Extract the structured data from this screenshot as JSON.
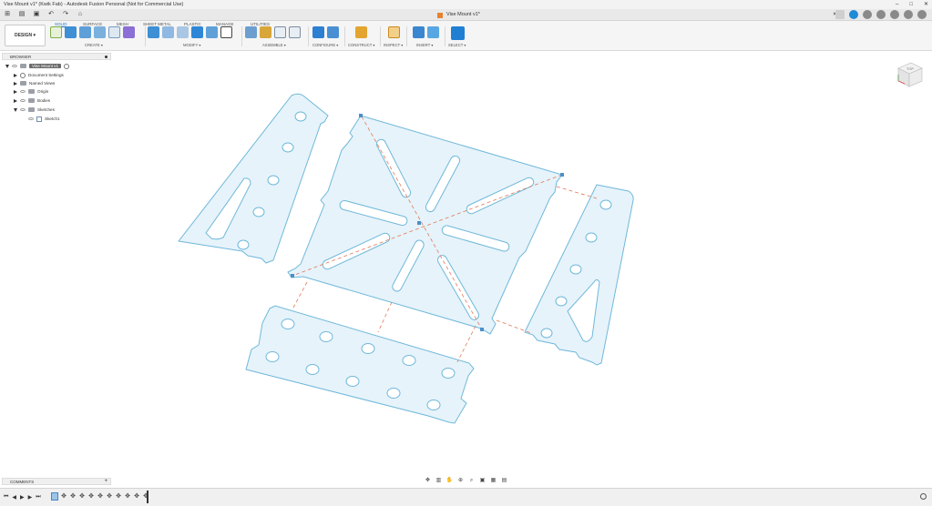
{
  "window": {
    "title": "Vise Mount v1* (Kwik Fab) - Autodesk Fusion Personal (Not for Commercial Use)",
    "controls": [
      "–",
      "□",
      "✕"
    ]
  },
  "document_tab": {
    "name": "Vise Mount v1*",
    "close": "✕"
  },
  "ribbon": {
    "design_button": "DESIGN ▾",
    "tabs": [
      "SOLID",
      "SURFACE",
      "MESH",
      "SHEET METAL",
      "PLASTIC",
      "MANAGE",
      "UTILITIES"
    ],
    "active_tab": "SOLID",
    "groups": [
      "CREATE ▾",
      "MODIFY ▾",
      "ASSEMBLE ▾",
      "CONFIGURE ▾",
      "CONSTRUCT ▾",
      "INSPECT ▾",
      "INSERT ▾",
      "SELECT ▾"
    ]
  },
  "browser": {
    "header": "BROWSER",
    "root": "Vise Mount v1",
    "items": [
      "Document Settings",
      "Named Views",
      "Origin",
      "Bodies",
      "Sketches",
      "Sketch1"
    ]
  },
  "viewcube": {
    "face_label": "TOP"
  },
  "comments": {
    "label": "COMMENTS",
    "add": "+"
  },
  "colors": {
    "sketch_fill": "#e6f3fa",
    "sketch_stroke": "#6fb8da",
    "construction_line": "#e07a58",
    "accent": "#1b74c4"
  }
}
